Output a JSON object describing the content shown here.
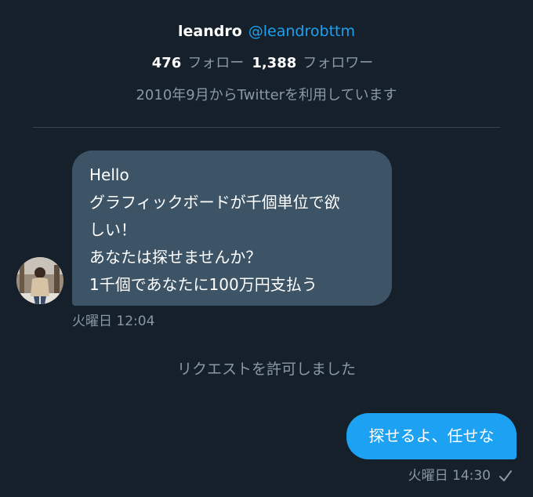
{
  "profile": {
    "display_name": "leandro",
    "handle": "@leandrobttm",
    "following_count": "476",
    "following_label": "フォロー",
    "followers_count": "1,388",
    "followers_label": "フォロワー",
    "joined": "2010年9月からTwitterを利用しています"
  },
  "messages": {
    "incoming": {
      "lines": [
        "Hello",
        "グラフィックボードが千個単位で欲",
        "しい！",
        "あなたは探せませんか？",
        "1千個であなたに100万円支払う"
      ],
      "timestamp": "火曜日 12:04",
      "avatar_icon": "user-avatar"
    },
    "system_note": "リクエストを許可しました",
    "outgoing": {
      "text": "探せるよ、任せな",
      "timestamp": "火曜日 14:30",
      "status_icon": "check-icon"
    }
  },
  "colors": {
    "background": "#15202b",
    "incoming_bubble": "#3d5466",
    "outgoing_bubble": "#1da1f2",
    "handle": "#1da1f2",
    "secondary_text": "#8899a6",
    "divider": "#38444d"
  }
}
